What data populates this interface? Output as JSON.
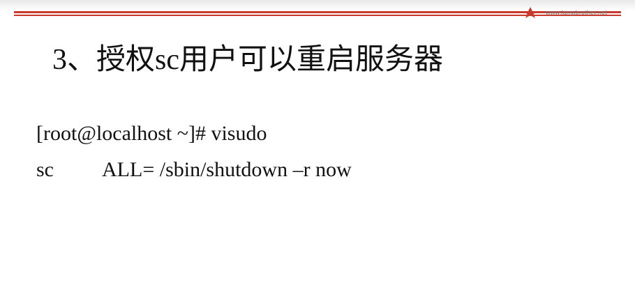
{
  "slide": {
    "logo": {
      "icon": "star-icon",
      "url_text": "www.lampbrother.net"
    },
    "accent_color": "#c8392b",
    "title": "3、授权sc用户可以重启服务器",
    "lines": [
      {
        "text": "[root@localhost ~]# visudo"
      },
      {
        "user": "sc",
        "rule": "ALL= /sbin/shutdown –r now"
      }
    ]
  }
}
